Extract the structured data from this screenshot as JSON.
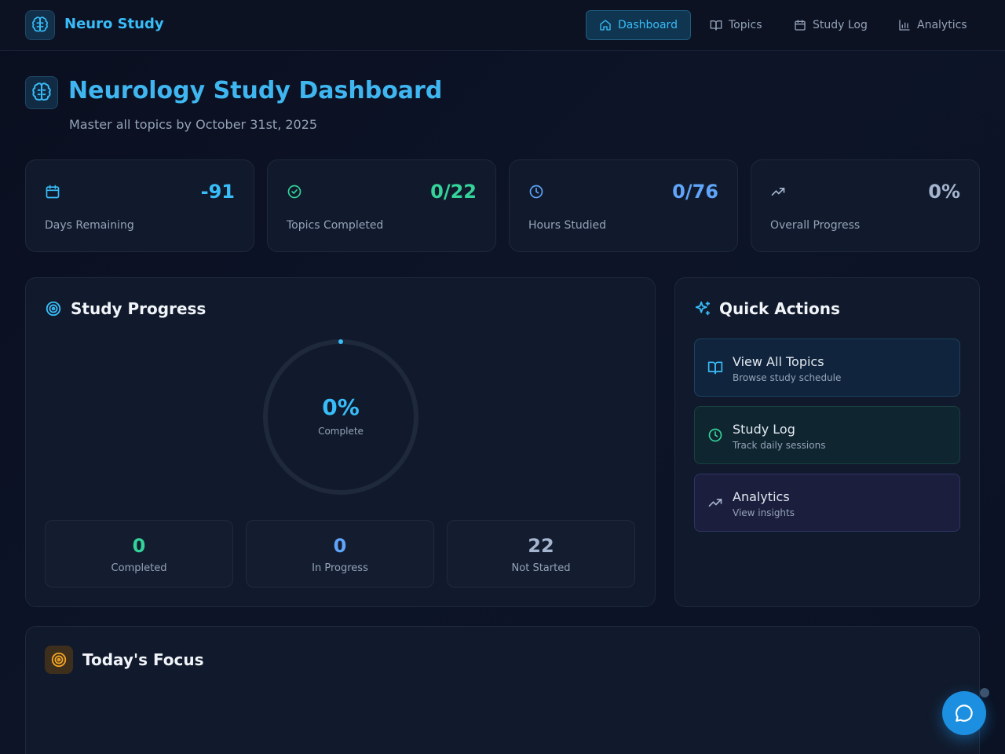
{
  "brand": {
    "name": "Neuro Study",
    "icon": "brain-icon"
  },
  "nav": [
    {
      "label": "Dashboard",
      "icon": "home-icon",
      "active": true
    },
    {
      "label": "Topics",
      "icon": "book-open-icon",
      "active": false
    },
    {
      "label": "Study Log",
      "icon": "calendar-icon",
      "active": false
    },
    {
      "label": "Analytics",
      "icon": "bar-chart-icon",
      "active": false
    }
  ],
  "header": {
    "title": "Neurology Study Dashboard",
    "subtitle": "Master all topics by October 31st, 2025"
  },
  "stats": [
    {
      "value": "-91",
      "label": "Days Remaining",
      "icon": "calendar-icon",
      "color": "#38bdf8"
    },
    {
      "value": "0/22",
      "label": "Topics Completed",
      "icon": "check-circle-icon",
      "color": "#34d399"
    },
    {
      "value": "0/76",
      "label": "Hours Studied",
      "icon": "clock-icon",
      "color": "#60a5fa"
    },
    {
      "value": "0%",
      "label": "Overall Progress",
      "icon": "trending-up-icon",
      "color": "#a5b4cf"
    }
  ],
  "progress": {
    "title": "Study Progress",
    "percent_label": "0%",
    "percent": 0,
    "caption": "Complete",
    "counts": [
      {
        "value": "0",
        "label": "Completed",
        "color": "#34d399"
      },
      {
        "value": "0",
        "label": "In Progress",
        "color": "#60a5fa"
      },
      {
        "value": "22",
        "label": "Not Started",
        "color": "#a5b4cf"
      }
    ]
  },
  "quick_actions": {
    "title": "Quick Actions",
    "items": [
      {
        "title": "View All Topics",
        "subtitle": "Browse study schedule",
        "icon": "book-open-icon"
      },
      {
        "title": "Study Log",
        "subtitle": "Track daily sessions",
        "icon": "clock-icon"
      },
      {
        "title": "Analytics",
        "subtitle": "View insights",
        "icon": "trending-up-icon"
      }
    ]
  },
  "focus": {
    "title": "Today's Focus",
    "icon": "target-icon"
  },
  "chat": {
    "icon": "chat-bubble-icon"
  }
}
